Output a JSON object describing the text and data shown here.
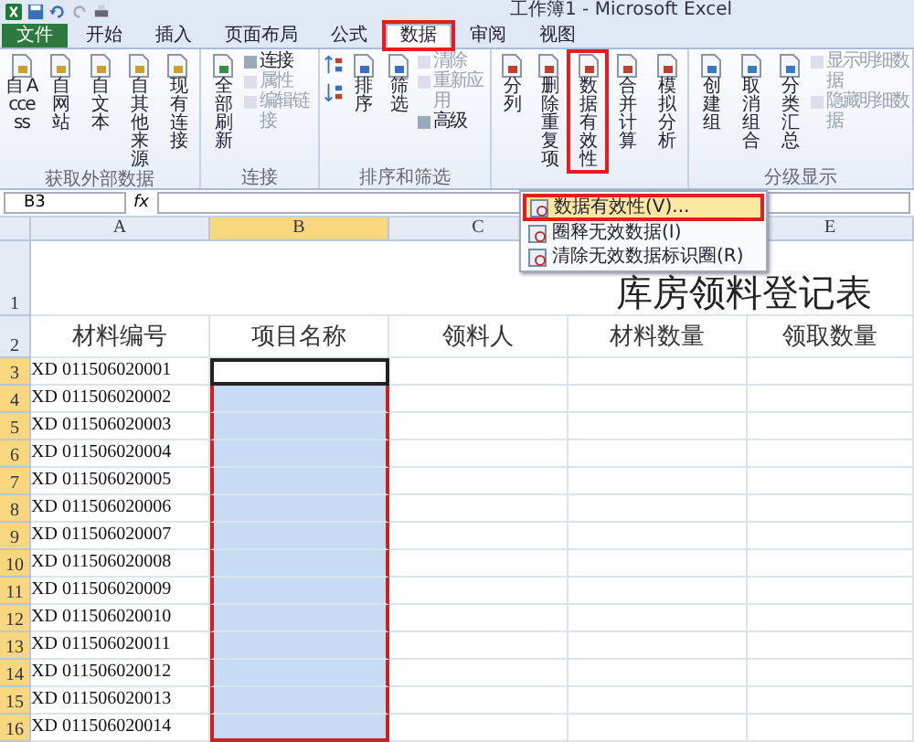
{
  "window": {
    "title": "工作簿1 - Microsoft Excel"
  },
  "tabs": [
    {
      "label": "文件",
      "selected": false,
      "kind": "file",
      "highlighted": false
    },
    {
      "label": "开始",
      "selected": false,
      "kind": "tab",
      "highlighted": false
    },
    {
      "label": "插入",
      "selected": false,
      "kind": "tab",
      "highlighted": false
    },
    {
      "label": "页面布局",
      "selected": false,
      "kind": "tab",
      "highlighted": false
    },
    {
      "label": "公式",
      "selected": false,
      "kind": "tab",
      "highlighted": false
    },
    {
      "label": "数据",
      "selected": true,
      "kind": "tab",
      "highlighted": true
    },
    {
      "label": "审阅",
      "selected": false,
      "kind": "tab",
      "highlighted": false
    },
    {
      "label": "视图",
      "selected": false,
      "kind": "tab",
      "highlighted": false
    }
  ],
  "ribbon_groups": [
    {
      "label": "获取外部数据",
      "items": [
        {
          "kind": "large",
          "label": "自 Access"
        },
        {
          "kind": "large",
          "label": "自网站"
        },
        {
          "kind": "large",
          "label": "自文本"
        },
        {
          "kind": "large",
          "label": "自其他来源"
        },
        {
          "kind": "large",
          "label": "现有连接"
        }
      ]
    },
    {
      "label": "连接",
      "items": [
        {
          "kind": "large",
          "label": "全部刷新"
        },
        {
          "kind": "stack",
          "children": [
            {
              "label": "连接",
              "disabled": false
            },
            {
              "label": "属性",
              "disabled": true
            },
            {
              "label": "编辑链接",
              "disabled": true
            }
          ]
        }
      ]
    },
    {
      "label": "排序和筛选",
      "items": [
        {
          "kind": "sort"
        },
        {
          "kind": "large",
          "label": "排序"
        },
        {
          "kind": "large",
          "label": "筛选"
        },
        {
          "kind": "stack",
          "children": [
            {
              "label": "清除",
              "disabled": true
            },
            {
              "label": "重新应用",
              "disabled": true
            },
            {
              "label": "高级",
              "disabled": false
            }
          ]
        }
      ]
    },
    {
      "items": [
        {
          "kind": "large",
          "label": "分列"
        },
        {
          "kind": "large",
          "label": "删除重复项"
        },
        {
          "kind": "large",
          "label": "数据有效性",
          "highlighted": true
        },
        {
          "kind": "large",
          "label": "合并计算"
        },
        {
          "kind": "large",
          "label": "模拟分析"
        }
      ]
    },
    {
      "label": "分级显示",
      "items": [
        {
          "kind": "large",
          "label": "创建组"
        },
        {
          "kind": "large",
          "label": "取消组合"
        },
        {
          "kind": "large",
          "label": "分类汇总"
        },
        {
          "kind": "stack",
          "children": [
            {
              "label": "显示明细数据",
              "disabled": true
            },
            {
              "label": "隐藏明细数据",
              "disabled": true
            }
          ]
        }
      ]
    }
  ],
  "menu": {
    "items": [
      {
        "label": "数据有效性(V)...",
        "highlighted": true
      },
      {
        "label": "圈释无效数据(I)",
        "highlighted": false
      },
      {
        "label": "清除无效数据标识圈(R)",
        "highlighted": false
      }
    ]
  },
  "name_box": "B3",
  "fx": "fx",
  "sheet": {
    "columns": [
      {
        "label": "A",
        "selected": false
      },
      {
        "label": "B",
        "selected": true
      },
      {
        "label": "C",
        "selected": false
      },
      {
        "covered": true
      },
      {
        "label": "E",
        "selected": false
      }
    ],
    "title_row_number": "1",
    "title": "库房领料登记表",
    "header_row_number": "2",
    "headers": [
      "材料编号",
      "项目名称",
      "领料人",
      "材料数量",
      "领取数量"
    ],
    "selection_marked": true,
    "rows": [
      {
        "number": "3",
        "code": "XD 011506020001",
        "selected": true,
        "active": true
      },
      {
        "number": "4",
        "code": "XD 011506020002",
        "selected": true,
        "active": false
      },
      {
        "number": "5",
        "code": "XD 011506020003",
        "selected": true,
        "active": false
      },
      {
        "number": "6",
        "code": "XD 011506020004",
        "selected": true,
        "active": false
      },
      {
        "number": "7",
        "code": "XD 011506020005",
        "selected": true,
        "active": false
      },
      {
        "number": "8",
        "code": "XD 011506020006",
        "selected": true,
        "active": false
      },
      {
        "number": "9",
        "code": "XD 011506020007",
        "selected": true,
        "active": false
      },
      {
        "number": "10",
        "code": "XD 011506020008",
        "selected": true,
        "active": false
      },
      {
        "number": "11",
        "code": "XD 011506020009",
        "selected": true,
        "active": false
      },
      {
        "number": "12",
        "code": "XD 011506020010",
        "selected": true,
        "active": false
      },
      {
        "number": "13",
        "code": "XD 011506020011",
        "selected": true,
        "active": false
      },
      {
        "number": "14",
        "code": "XD 011506020012",
        "selected": true,
        "active": false
      },
      {
        "number": "15",
        "code": "XD 011506020013",
        "selected": true,
        "active": false
      },
      {
        "number": "16",
        "code": "XD 011506020014",
        "selected": true,
        "active": false
      }
    ]
  }
}
